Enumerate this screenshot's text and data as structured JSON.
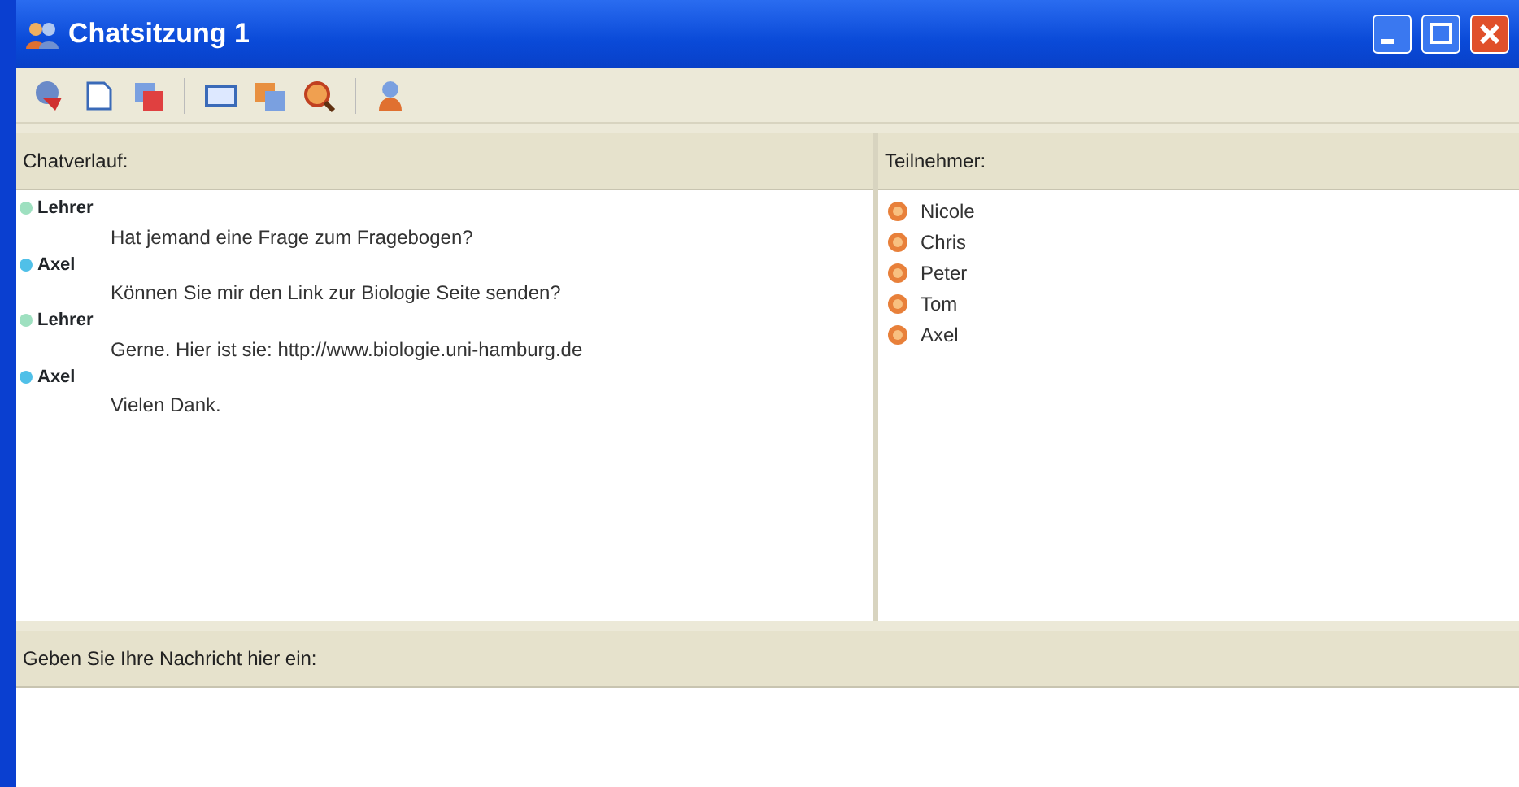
{
  "window": {
    "title": "Chatsitzung 1"
  },
  "chat": {
    "header": "Chatverlauf:",
    "messages": [
      {
        "sender": "Lehrer",
        "color": "#9ee0c0",
        "text": "Hat jemand eine Frage zum Fragebogen?"
      },
      {
        "sender": "Axel",
        "color": "#50c0e8",
        "text": "Können Sie mir den Link zur Biologie Seite senden?"
      },
      {
        "sender": "Lehrer",
        "color": "#9ee0c0",
        "text": "Gerne. Hier ist sie: http://www.biologie.uni-hamburg.de"
      },
      {
        "sender": "Axel",
        "color": "#50c0e8",
        "text": "Vielen Dank."
      }
    ]
  },
  "participants": {
    "header": "Teilnehmer:",
    "items": [
      "Nicole",
      "Chris",
      "Peter",
      "Tom",
      "Axel"
    ]
  },
  "input": {
    "header": "Geben Sie Ihre Nachricht hier ein:"
  }
}
